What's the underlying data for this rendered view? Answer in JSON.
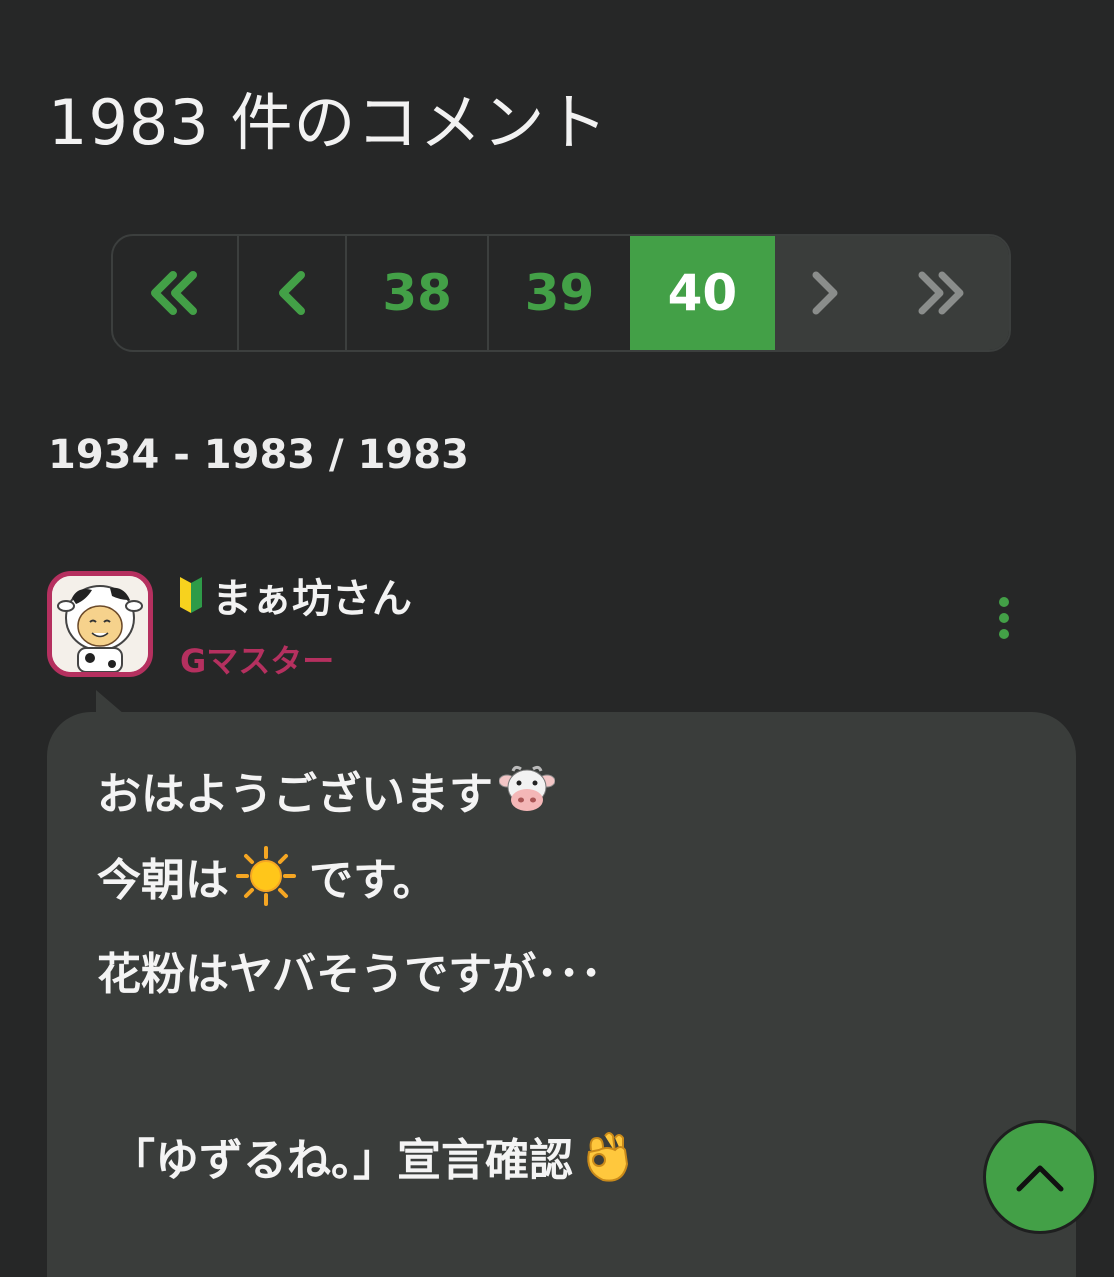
{
  "header": {
    "title": "1983 件のコメント"
  },
  "pagination": {
    "first_icon": "double-chevron-left-icon",
    "prev_icon": "chevron-left-icon",
    "pages": [
      "38",
      "39"
    ],
    "current": "40",
    "next_icon": "chevron-right-icon",
    "last_icon": "double-chevron-right-icon",
    "accent_color": "#43a047"
  },
  "range": {
    "text": "1934 - 1983 / 1983"
  },
  "comment": {
    "badge_icon": "beginner-mark-icon",
    "author": "まぁ坊さん",
    "rank": "Gマスター",
    "rank_color": "#b5305f",
    "menu_icon": "kebab-menu-icon",
    "lines": [
      {
        "text": "おはようございます",
        "emoji": "cow-face-icon"
      },
      {
        "text": "今朝は",
        "emoji": "sun-icon",
        "after": "です。"
      },
      {
        "text": "花粉はヤバそうですが･･･"
      },
      {
        "text": "「ゆずるね。」宣言確認",
        "emoji": "ok-hand-icon"
      }
    ]
  },
  "scroll_top": {
    "icon": "chevron-up-icon"
  }
}
